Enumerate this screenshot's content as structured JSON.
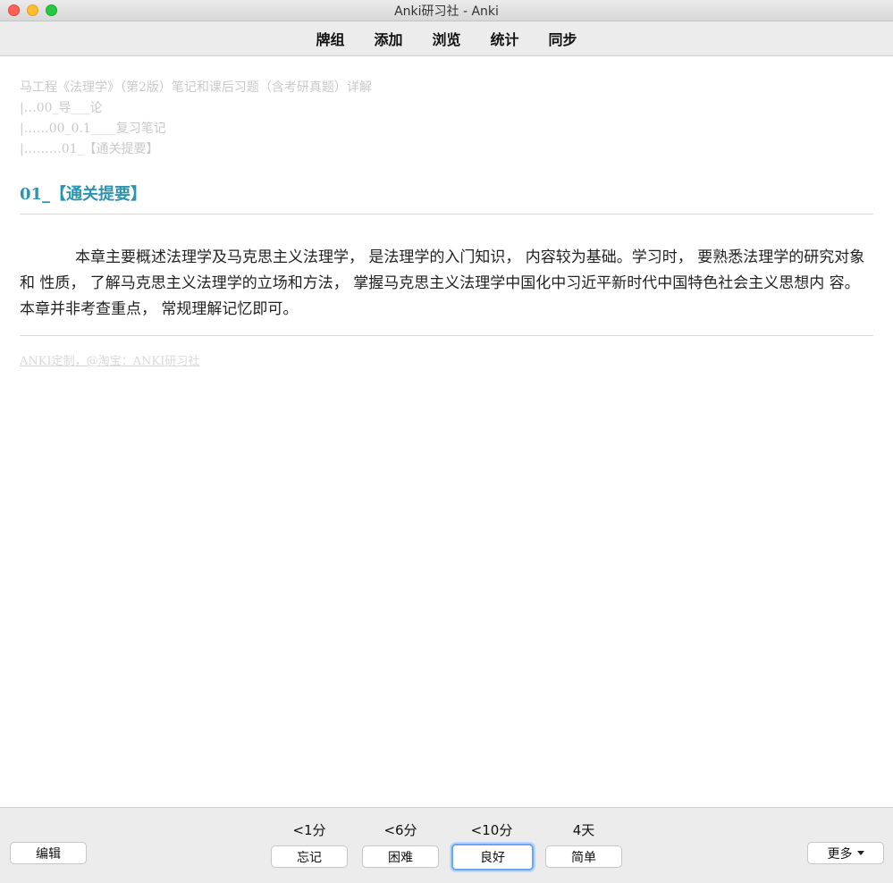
{
  "window": {
    "title": "Anki研习社 - Anki"
  },
  "toolbar": {
    "items": [
      {
        "label": "牌组"
      },
      {
        "label": "添加"
      },
      {
        "label": "浏览"
      },
      {
        "label": "统计"
      },
      {
        "label": "同步"
      }
    ]
  },
  "card": {
    "breadcrumb": [
      "马工程《法理学》（第2版）笔记和课后习题（含考研真题）详解",
      "|…00_导___论",
      "|……00_0.1____复习笔记",
      "|………01_【通关提要】"
    ],
    "heading": "01_【通关提要】",
    "body": "本章主要概述法理学及马克思主义法理学， 是法理学的入门知识， 内容较为基础。学习时， 要熟悉法理学的研究对象和 性质， 了解马克思主义法理学的立场和方法， 掌握马克思主义法理学中国化中习近平新时代中国特色社会主义思想内 容。本章并非考查重点， 常规理解记忆即可。",
    "footer": "ANKI定制，@淘宝：ANKI研习社"
  },
  "bottom": {
    "edit_label": "编辑",
    "more_label": "更多",
    "answers": [
      {
        "interval": "<1分",
        "label": "忘记"
      },
      {
        "interval": "<6分",
        "label": "困难"
      },
      {
        "interval": "<10分",
        "label": "良好"
      },
      {
        "interval": "4天",
        "label": "简单"
      }
    ]
  },
  "colors": {
    "heading": "#2e93ae",
    "rule": "#b8e4ef",
    "focus": "#6aa6f5"
  }
}
